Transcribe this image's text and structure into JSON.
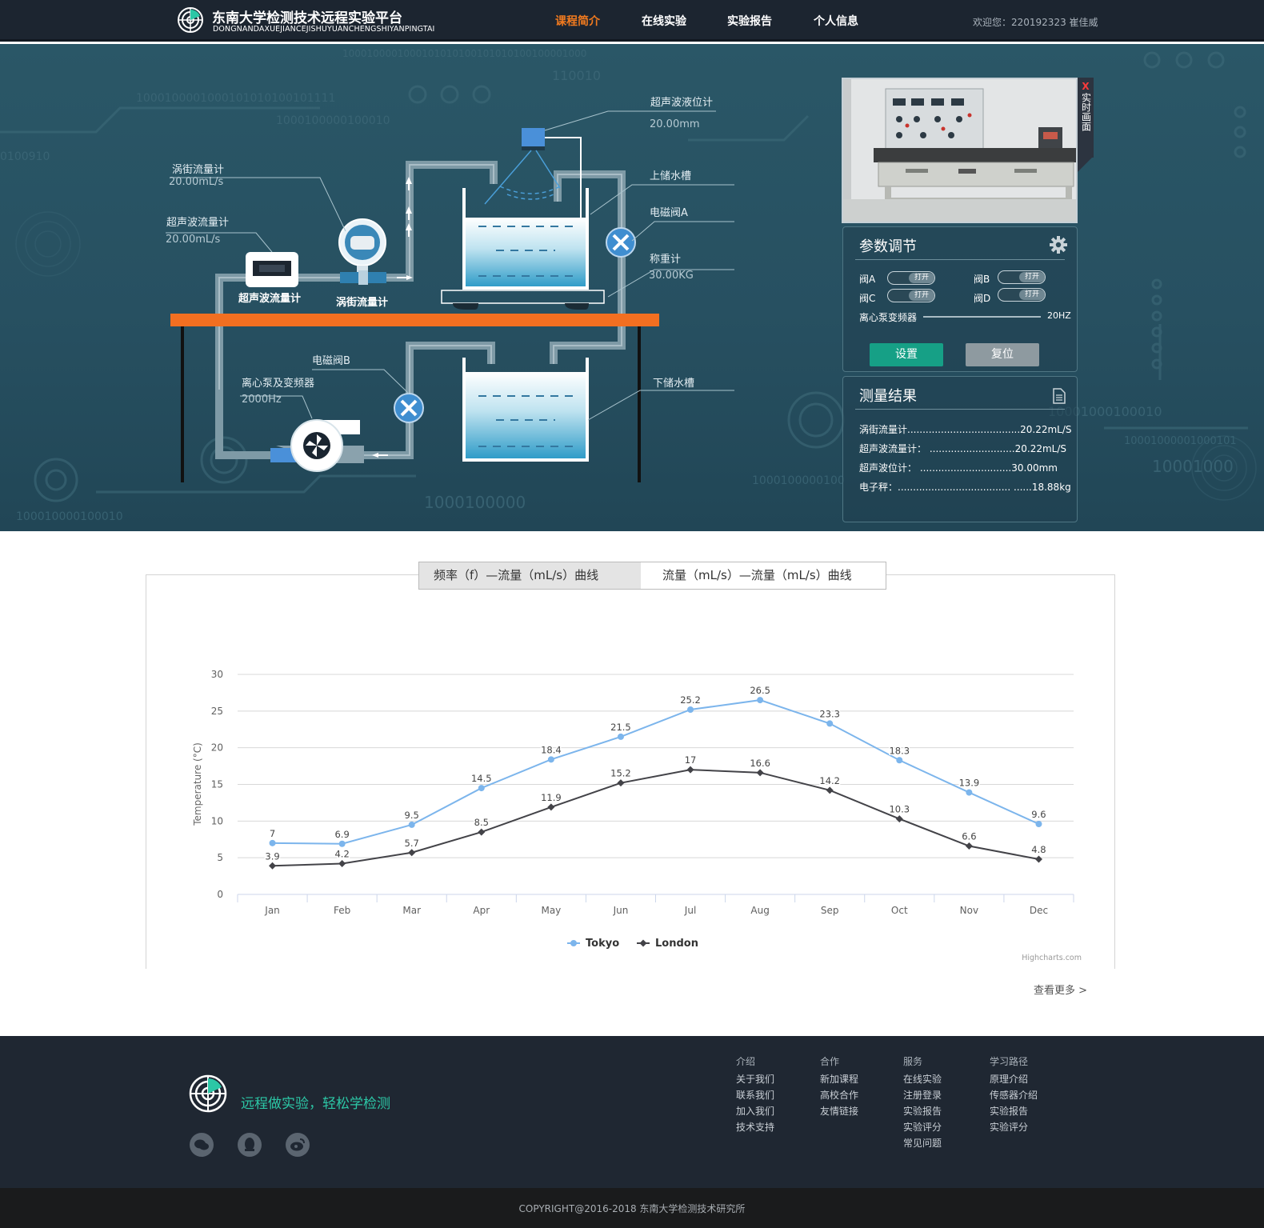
{
  "header": {
    "title_cn": "东南大学检测技术远程实验平台",
    "title_en": "DONGNANDAXUEJIANCEJISHUYUANCHENGSHIYANPINGTAI",
    "nav": [
      {
        "label": "课程简介",
        "active": true
      },
      {
        "label": "在线实验",
        "active": false
      },
      {
        "label": "实验报告",
        "active": false
      },
      {
        "label": "个人信息",
        "active": false
      }
    ],
    "welcome": "欢迎您：220192323 崔佳威"
  },
  "diagram": {
    "ultrasonic_level": {
      "label": "超声波液位计",
      "value": "20.00mm"
    },
    "vortex_flow": {
      "label": "涡街流量计",
      "value": "20.00mL/s"
    },
    "ultrasonic_flow": {
      "label": "超声波流量计",
      "value": "20.00mL/s"
    },
    "upper_tank": "上储水槽",
    "valve_a": "电磁阀A",
    "scale": {
      "label": "称重计",
      "value": "30.00KG"
    },
    "valve_b": "电磁阀B",
    "pump": {
      "label": "离心泵及变频器",
      "value": "2000Hz"
    },
    "lower_tank": "下储水槽",
    "device_ultrasonic": "超声波流量计",
    "device_vortex": "涡街流量计"
  },
  "camera": {
    "tab_label": "实时画面",
    "close": "X"
  },
  "params": {
    "title": "参数调节",
    "valves": [
      {
        "label": "阀A",
        "state": "打开"
      },
      {
        "label": "阀B",
        "state": "打开"
      },
      {
        "label": "阀C",
        "state": "打开"
      },
      {
        "label": "阀D",
        "state": "打开"
      }
    ],
    "pump_label": "离心泵变频器",
    "pump_value": "20HZ",
    "set_label": "设置",
    "reset_label": "复位"
  },
  "results": {
    "title": "测量结果",
    "rows": [
      "涡街流量计.....................................20.22mL/S",
      "超声波流量计： ............................20.22mL/S",
      "超声波位计： ..............................30.00mm",
      "电子秤：..................................... ......18.88kg"
    ]
  },
  "tabs": [
    "频率（f）—流量（mL/s）曲线",
    "流量（mL/s）—流量（mL/s）曲线"
  ],
  "chart_data": {
    "type": "line",
    "categories": [
      "Jan",
      "Feb",
      "Mar",
      "Apr",
      "May",
      "Jun",
      "Jul",
      "Aug",
      "Sep",
      "Oct",
      "Nov",
      "Dec"
    ],
    "series": [
      {
        "name": "Tokyo",
        "color": "#7cb5ec",
        "values": [
          7,
          6.9,
          9.5,
          14.5,
          18.4,
          21.5,
          25.2,
          26.5,
          23.3,
          18.3,
          13.9,
          9.6
        ]
      },
      {
        "name": "London",
        "color": "#434348",
        "values": [
          3.9,
          4.2,
          5.7,
          8.5,
          11.9,
          15.2,
          17,
          16.6,
          14.2,
          10.3,
          6.6,
          4.8
        ]
      }
    ],
    "ylabel": "Temperature (°C)",
    "ylim": [
      0,
      30
    ],
    "yticks": [
      0,
      5,
      10,
      15,
      20,
      25,
      30
    ],
    "grid": true,
    "legend": "bottom",
    "credits": "Highcharts.com"
  },
  "more_link": "查看更多 >",
  "footer": {
    "slogan": "远程做实验，轻松学检测",
    "columns": [
      {
        "title": "介绍",
        "links": [
          "关于我们",
          "联系我们",
          "加入我们",
          "技术支持"
        ]
      },
      {
        "title": "合作",
        "links": [
          "新加课程",
          "高校合作",
          "友情链接"
        ]
      },
      {
        "title": "服务",
        "links": [
          "在线实验",
          "注册登录",
          "实验报告",
          "实验评分",
          "常见问题"
        ]
      },
      {
        "title": "学习路径",
        "links": [
          "原理介绍",
          "传感器介绍",
          "实验报告",
          "实验评分"
        ]
      }
    ],
    "copyright": "COPYRIGHT@2016-2018 东南大学检测技术研究所"
  }
}
